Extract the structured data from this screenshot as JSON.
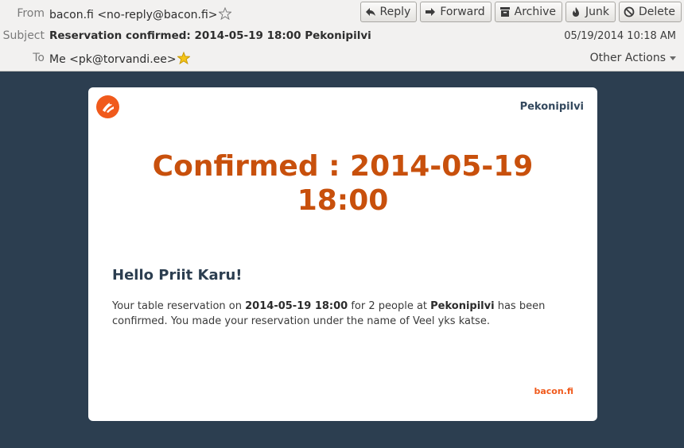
{
  "header": {
    "from_label": "From",
    "from_value": "bacon.fi <no-reply@bacon.fi>",
    "subject_label": "Subject",
    "subject_value": "Reservation confirmed: 2014-05-19 18:00 Pekonipilvi",
    "to_label": "To",
    "to_value": "Me <pk@torvandi.ee>",
    "date": "05/19/2014 10:18 AM",
    "other_actions": "Other Actions"
  },
  "toolbar": {
    "reply": "Reply",
    "forward": "Forward",
    "archive": "Archive",
    "junk": "Junk",
    "delete": "Delete"
  },
  "email": {
    "brand": "Pekonipilvi",
    "headline": "Confirmed : 2014-05-19 18:00",
    "greeting": "Hello Priit Karu!",
    "body_part1": "Your table reservation on ",
    "body_bold_datetime": "2014-05-19 18:00",
    "body_part2": " for 2 people at ",
    "body_bold_place": "Pekonipilvi",
    "body_part3": " has been confirmed. You made your reservation under the name of Veel yks katse.",
    "footer_brand": "bacon.fi"
  },
  "colors": {
    "background": "#2c3e50",
    "accent_orange": "#f05a1c",
    "headline": "#c8500c"
  },
  "icons": {
    "from_star": "star-outline-icon",
    "to_star": "star-filled-icon",
    "logo": "bacon-logo-icon"
  }
}
